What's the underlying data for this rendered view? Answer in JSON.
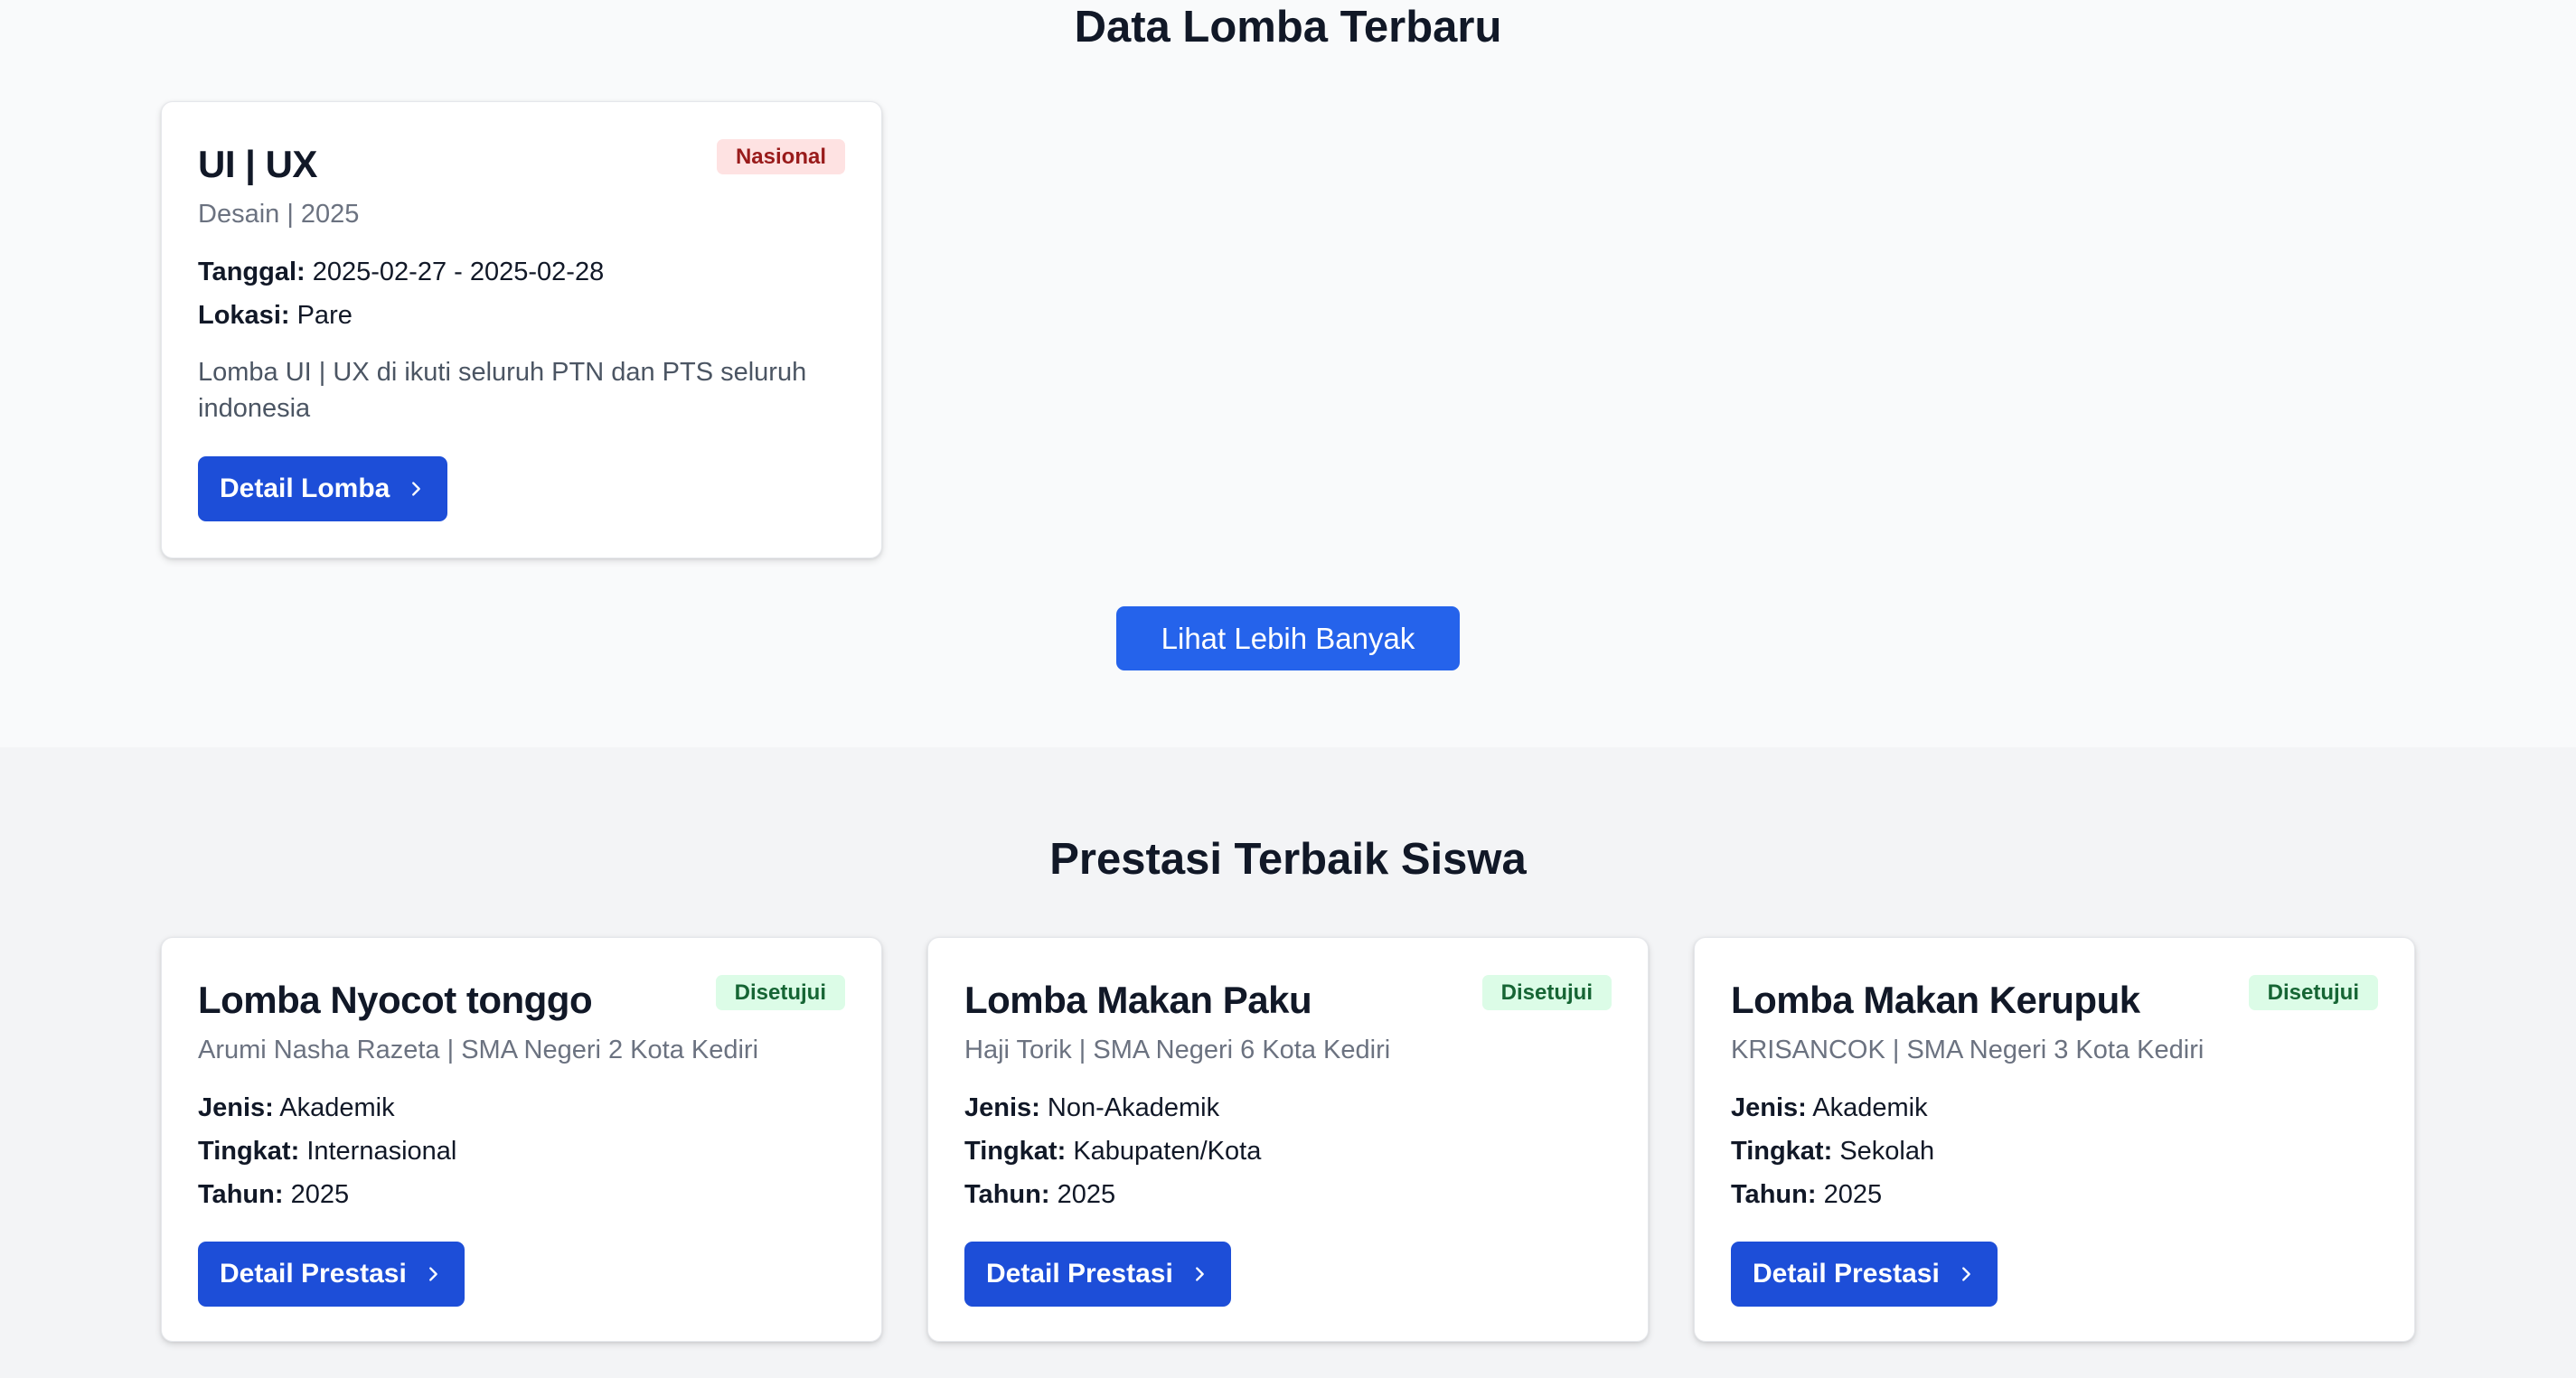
{
  "lomba_section": {
    "title": "Data Lomba Terbaru",
    "cards": [
      {
        "title": "UI | UX",
        "subtitle": "Desain | 2025",
        "badge": "Nasional",
        "date_label": "Tanggal:",
        "date_value": "2025-02-27 - 2025-02-28",
        "location_label": "Lokasi:",
        "location_value": "Pare",
        "description": "Lomba UI | UX di ikuti seluruh PTN dan PTS seluruh indonesia",
        "button_label": "Detail Lomba"
      }
    ],
    "more_button": "Lihat Lebih Banyak"
  },
  "prestasi_section": {
    "title": "Prestasi Terbaik Siswa",
    "cards": [
      {
        "title": "Lomba Nyocot tonggo",
        "subtitle": "Arumi Nasha Razeta | SMA Negeri 2 Kota Kediri",
        "badge": "Disetujui",
        "jenis_label": "Jenis:",
        "jenis_value": "Akademik",
        "tingkat_label": "Tingkat:",
        "tingkat_value": "Internasional",
        "tahun_label": "Tahun:",
        "tahun_value": "2025",
        "button_label": "Detail Prestasi"
      },
      {
        "title": "Lomba Makan Paku",
        "subtitle": "Haji Torik | SMA Negeri 6 Kota Kediri",
        "badge": "Disetujui",
        "jenis_label": "Jenis:",
        "jenis_value": "Non-Akademik",
        "tingkat_label": "Tingkat:",
        "tingkat_value": "Kabupaten/Kota",
        "tahun_label": "Tahun:",
        "tahun_value": "2025",
        "button_label": "Detail Prestasi"
      },
      {
        "title": "Lomba Makan Kerupuk",
        "subtitle": "KRISANCOK | SMA Negeri 3 Kota Kediri",
        "badge": "Disetujui",
        "jenis_label": "Jenis:",
        "jenis_value": "Akademik",
        "tingkat_label": "Tingkat:",
        "tingkat_value": "Sekolah",
        "tahun_label": "Tahun:",
        "tahun_value": "2025",
        "button_label": "Detail Prestasi"
      }
    ]
  },
  "colors": {
    "primary_button": "#1d4ed8",
    "more_button": "#2563eb",
    "badge_red_bg": "#fee2e2",
    "badge_red_text": "#991b1b",
    "badge_green_bg": "#dcfce7",
    "badge_green_text": "#166534"
  },
  "icons": {
    "button_chevron": "chevron-right-icon"
  }
}
